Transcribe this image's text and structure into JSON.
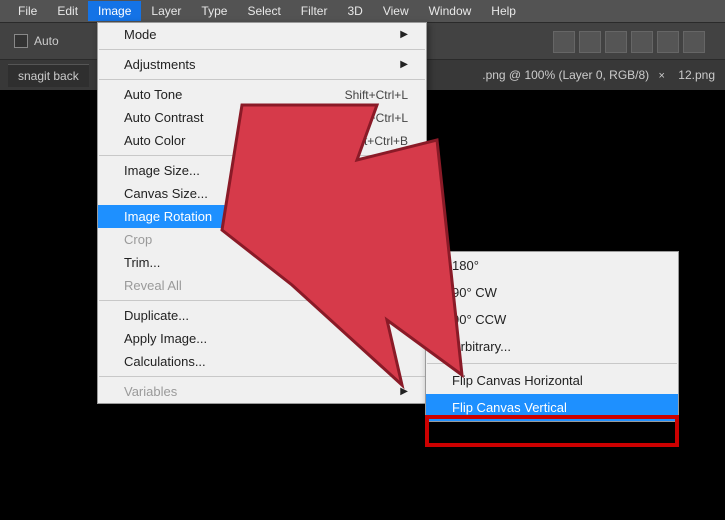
{
  "menubar": [
    "File",
    "Edit",
    "Image",
    "Layer",
    "Type",
    "Select",
    "Filter",
    "3D",
    "View",
    "Window",
    "Help"
  ],
  "menubar_active_index": 2,
  "toolbar": {
    "auto_label": "Auto"
  },
  "tabs": {
    "left_tab": "snagit back",
    "right_text": ".png @ 100% (Layer 0, RGB/8)",
    "right_tab2": "12.png"
  },
  "image_menu": {
    "mode": "Mode",
    "adjustments": "Adjustments",
    "auto_tone": {
      "label": "Auto Tone",
      "shortcut": "Shift+Ctrl+L"
    },
    "auto_contrast": {
      "label": "Auto Contrast",
      "shortcut": "Alt+Shift+Ctrl+L"
    },
    "auto_color": {
      "label": "Auto Color",
      "shortcut": "Shift+Ctrl+B"
    },
    "image_size": "Image Size...",
    "canvas_size": "Canvas Size...",
    "image_rotation": "Image Rotation",
    "crop": "Crop",
    "trim": "Trim...",
    "reveal_all": "Reveal All",
    "duplicate": "Duplicate...",
    "apply_image": "Apply Image...",
    "calculations": "Calculations...",
    "variables": "Variables"
  },
  "rotation_submenu": {
    "r180": "180°",
    "r90cw": "90° CW",
    "r90ccw": "90° CCW",
    "arbitrary": "Arbitrary...",
    "flip_h": "Flip Canvas Horizontal",
    "flip_v": "Flip Canvas Vertical"
  }
}
